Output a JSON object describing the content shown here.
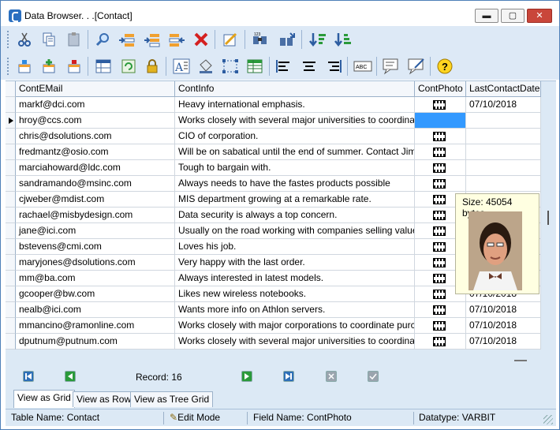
{
  "window": {
    "title": "Data Browser. . .[Contact]",
    "buttons": {
      "minimize": "▬",
      "maximize": "▢",
      "close": "✕"
    }
  },
  "toolbar1": [
    "cut-icon",
    "copy-icon",
    "paste-icon",
    "find-icon",
    "insert-row-icon",
    "append-row-icon",
    "move-row-icon",
    "delete-icon",
    "edit-icon",
    "binoculars-icon",
    "find-next-icon",
    "sort-ascending-icon",
    "sort-descending-icon"
  ],
  "toolbar2": [
    "insert-child-icon",
    "add-icon",
    "remove-icon",
    "table-icon",
    "refresh-icon",
    "lock-icon",
    "font-icon",
    "fill-icon",
    "select-icon",
    "grid-icon",
    "align-left-icon",
    "align-center-icon",
    "align-right-icon",
    "spell-icon",
    "memo-icon",
    "memo-edit-icon",
    "help-icon"
  ],
  "grid": {
    "columns": [
      "ContEMail",
      "ContInfo",
      "ContPhoto",
      "LastContactDate"
    ],
    "rows": [
      {
        "email": "markf@dci.com",
        "info": "Heavy international emphasis.",
        "date": "07/10/2018"
      },
      {
        "email": "hroy@ccs.com",
        "info": "Works closely with several major universities to coordinat",
        "date": ""
      },
      {
        "email": "chris@dsolutions.com",
        "info": "CIO of corporation.",
        "date": ""
      },
      {
        "email": "fredmantz@osio.com",
        "info": "Will be on sabatical until the end of summer.  Contact Jim",
        "date": ""
      },
      {
        "email": "marciahoward@ldc.com",
        "info": "Tough to bargain with.",
        "date": ""
      },
      {
        "email": "sandramando@msinc.com",
        "info": "Always needs to have the fastes products possible",
        "date": ""
      },
      {
        "email": "cjweber@mdist.com",
        "info": "MIS department growing at a remarkable rate.",
        "date": ""
      },
      {
        "email": "rachael@misbydesign.com",
        "info": "Data security is always a top concern.",
        "date": ""
      },
      {
        "email": "jane@ici.com",
        "info": "Usually on the road working with companies selling value",
        "date": "07/10/2018"
      },
      {
        "email": "bstevens@cmi.com",
        "info": "Loves his job.",
        "date": "07/10/2018"
      },
      {
        "email": "maryjones@dsolutions.com",
        "info": "Very happy with the last order.",
        "date": "07/10/2018"
      },
      {
        "email": "mm@ba.com",
        "info": "Always interested in latest models.",
        "date": "07/10/2018"
      },
      {
        "email": "gcooper@bw.com",
        "info": "Likes new wireless notebooks.",
        "date": "07/10/2018"
      },
      {
        "email": "nealb@ici.com",
        "info": "Wants more info on Athlon servers.",
        "date": "07/10/2018"
      },
      {
        "email": "mmancino@ramonline.com",
        "info": "Works closely with major corporations to coordinate purc",
        "date": "07/10/2018"
      },
      {
        "email": "dputnum@putnum.com",
        "info": "Works closely with several major universities to coordinat",
        "date": "07/10/2018"
      }
    ],
    "current_row": 1
  },
  "tooltip": {
    "size": "Size: 45054 bytes."
  },
  "nav": {
    "record": "Record: 16"
  },
  "tabs": [
    "View as Grid",
    "View as Row",
    "View as Tree Grid"
  ],
  "status": {
    "table": "Table Name: Contact",
    "mode": "Edit Mode",
    "field": "Field Name: ContPhoto",
    "datatype": "Datatype: VARBIT"
  }
}
